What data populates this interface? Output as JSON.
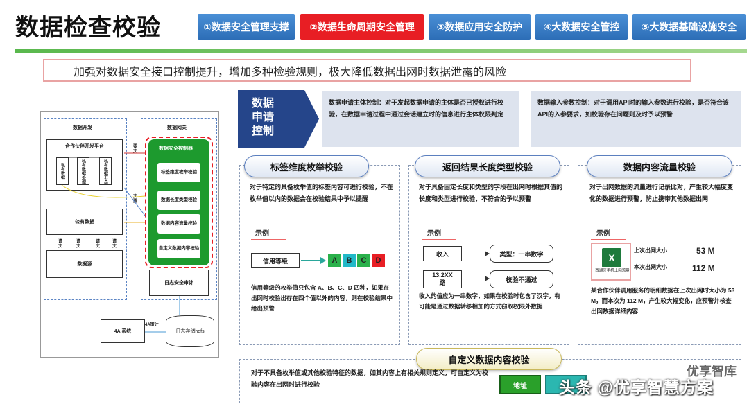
{
  "title": "数据检查校验",
  "tabs": [
    {
      "label": "①数据安全管理支撑",
      "active": false
    },
    {
      "label": "②数据生命周期安全管理",
      "active": true
    },
    {
      "label": "③数据应用安全防护",
      "active": false
    },
    {
      "label": "④大数据安全管控",
      "active": false
    },
    {
      "label": "⑤大数据基础设施安全",
      "active": false
    }
  ],
  "banner": "加强对数据安全接口控制提升，增加多种检验规则，极大降低数据出网时数据泄露的风险",
  "diagram": {
    "dev_title": "数据开发",
    "gateway_title": "数据网关",
    "partner_platform": "合作伙伴开发平台",
    "col1": "私有数据",
    "col2": "私有数据处理",
    "col3": "私有数据汇总",
    "public_data": "公有数据",
    "data_source": "数据源",
    "controller": "数据安全控制器",
    "check1": "标签维度枚举校验",
    "check2": "数据长度类型校验",
    "check3": "数据内容流量校验",
    "check4": "自定义数据内容校验",
    "log_audit": "日志安全审计",
    "system_4a": "4A 系统",
    "audit_4a": "4A审计",
    "log_storage": "日志存储hdfs",
    "req1": "要文",
    "req2": "文要",
    "req3": "请文",
    "req4": "请文",
    "req5": "请文",
    "req6": "请文"
  },
  "control": {
    "label": "数据申请控制",
    "subject_text": "数据申请主体控制：对于发起数据申请的主体是否已授权进行校验，在数据申请过程中通过会话建立时的信息进行主体权限判定",
    "param_text": "数据输入参数控制：对于调用API时的输入参数进行校验，是否符合该API的入参要求，如校验存在问题则及时予以预警"
  },
  "panel1": {
    "title": "标签维度枚举校验",
    "desc": "对于特定的具备枚举值的标签内容可进行校验，不在枚举值以内的数据会在校验结果中予以提醒",
    "example": "示例",
    "field": "信用等级",
    "values": [
      "A",
      "B",
      "C",
      "D"
    ],
    "value_colors": [
      "#2ab14b",
      "#22b9c8",
      "#2ab14b",
      "#e81e24"
    ],
    "note": "信用等级的枚举值只包含 A、B、C、D 四种，如果在出网时校验出存在四个值以外的内容，则在校验结果中给出预警"
  },
  "panel2": {
    "title": "返回结果长度类型校验",
    "desc": "对于具备固定长度和类型的字段在出网时根据其值的长度和类型进行校验，不符合的予以预警",
    "example": "示例",
    "input_label": "收入",
    "input_type": "类型：一串数字",
    "input_value": "13.2XX\n路",
    "check_result": "校验不通过",
    "note": "收入的值应为一串数字，如果在校验时包含了汉字，有可能是通过数据转移相加的方式窃取权限外数据"
  },
  "panel3": {
    "title": "数据内容流量校验",
    "desc": "对于出网数据的流量进行记录比对，产生较大幅度变化的数据进行预警，防止携带其他数据出网",
    "example": "示例",
    "file_label": "西湖区手机上网流量",
    "last_label": "上次出网大小",
    "last_value": "53 M",
    "this_label": "本次出网大小",
    "this_value": "112 M",
    "note": "某合作伙伴调用服务的明细数据在上次出网时大小为 53 M，而本次为 112 M，产生较大幅变化，应预警并核查出网数据详细内容"
  },
  "panel4": {
    "title": "自定义数据内容校验",
    "desc": "对于不具备枚举值或其他校验特征的数据，如其内容上有相关规则定义，可自定义为校验内容在出网时进行校验",
    "button": "地址"
  },
  "watermark1": "优享智库",
  "watermark2": "头条 @优享智慧方案"
}
